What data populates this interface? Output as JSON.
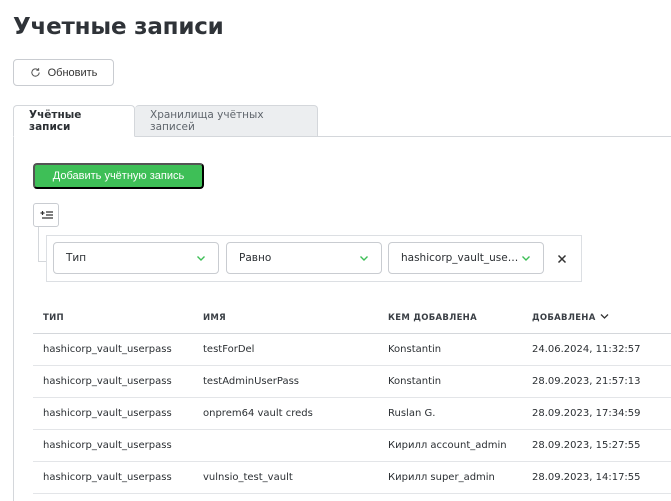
{
  "page": {
    "title": "Учетные записи"
  },
  "toolbar": {
    "refresh_label": "Обновить"
  },
  "tabs": [
    {
      "label": "Учётные записи",
      "active": true
    },
    {
      "label": "Хранилища учётных записей",
      "active": false
    }
  ],
  "actions": {
    "add_label": "Добавить учётную запись"
  },
  "filter": {
    "field": "Тип",
    "operator": "Равно",
    "value": "hashicorp_vault_userpass"
  },
  "table": {
    "columns": [
      "ТИП",
      "ИМЯ",
      "КЕМ ДОБАВЛЕНА",
      "ДОБАВЛЕНА"
    ],
    "sort_column": "ДОБАВЛЕНА",
    "sort_direction": "desc",
    "rows": [
      {
        "type": "hashicorp_vault_userpass",
        "name": "testForDel",
        "added_by": "Konstantin",
        "added": "24.06.2024, 11:32:57"
      },
      {
        "type": "hashicorp_vault_userpass",
        "name": "testAdminUserPass",
        "added_by": "Konstantin",
        "added": "28.09.2023, 21:57:13"
      },
      {
        "type": "hashicorp_vault_userpass",
        "name": "onprem64 vault creds",
        "added_by": "Ruslan G.",
        "added": "28.09.2023, 17:34:59"
      },
      {
        "type": "hashicorp_vault_userpass",
        "name": "",
        "added_by": "Кирилл account_admin",
        "added": "28.09.2023, 15:27:55"
      },
      {
        "type": "hashicorp_vault_userpass",
        "name": "vulnsio_test_vault",
        "added_by": "Кирилл super_admin",
        "added": "28.09.2023, 14:17:55"
      }
    ]
  },
  "colors": {
    "accent_green": "#3ebf57",
    "border": "#d4d7db",
    "text": "#2b2f33"
  }
}
